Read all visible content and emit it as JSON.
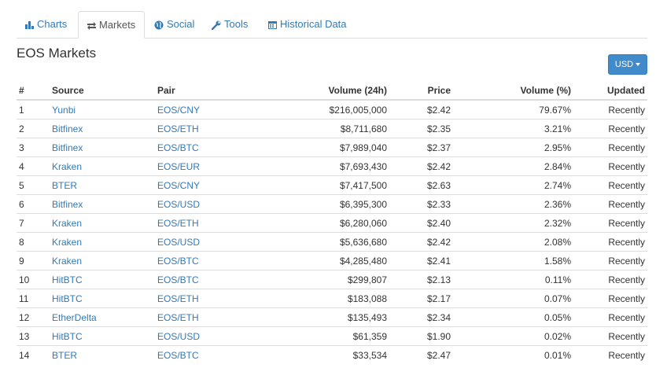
{
  "tabs": [
    {
      "label": "Charts",
      "icon": "bar-chart-icon"
    },
    {
      "label": "Markets",
      "icon": "exchange-icon"
    },
    {
      "label": "Social",
      "icon": "globe-icon"
    },
    {
      "label": "Tools",
      "icon": "wrench-icon"
    },
    {
      "label": "Historical Data",
      "icon": "calendar-icon"
    }
  ],
  "active_tab": "Markets",
  "page_title": "EOS Markets",
  "currency_button": "USD",
  "table": {
    "headers": [
      "#",
      "Source",
      "Pair",
      "Volume (24h)",
      "Price",
      "Volume (%)",
      "Updated"
    ],
    "rows": [
      [
        "1",
        "Yunbi",
        "EOS/CNY",
        "$216,005,000",
        "$2.42",
        "79.67%",
        "Recently"
      ],
      [
        "2",
        "Bitfinex",
        "EOS/ETH",
        "$8,711,680",
        "$2.35",
        "3.21%",
        "Recently"
      ],
      [
        "3",
        "Bitfinex",
        "EOS/BTC",
        "$7,989,040",
        "$2.37",
        "2.95%",
        "Recently"
      ],
      [
        "4",
        "Kraken",
        "EOS/EUR",
        "$7,693,430",
        "$2.42",
        "2.84%",
        "Recently"
      ],
      [
        "5",
        "BTER",
        "EOS/CNY",
        "$7,417,500",
        "$2.63",
        "2.74%",
        "Recently"
      ],
      [
        "6",
        "Bitfinex",
        "EOS/USD",
        "$6,395,300",
        "$2.33",
        "2.36%",
        "Recently"
      ],
      [
        "7",
        "Kraken",
        "EOS/ETH",
        "$6,280,060",
        "$2.40",
        "2.32%",
        "Recently"
      ],
      [
        "8",
        "Kraken",
        "EOS/USD",
        "$5,636,680",
        "$2.42",
        "2.08%",
        "Recently"
      ],
      [
        "9",
        "Kraken",
        "EOS/BTC",
        "$4,285,480",
        "$2.41",
        "1.58%",
        "Recently"
      ],
      [
        "10",
        "HitBTC",
        "EOS/BTC",
        "$299,807",
        "$2.13",
        "0.11%",
        "Recently"
      ],
      [
        "11",
        "HitBTC",
        "EOS/ETH",
        "$183,088",
        "$2.17",
        "0.07%",
        "Recently"
      ],
      [
        "12",
        "EtherDelta",
        "EOS/ETH",
        "$135,493",
        "$2.34",
        "0.05%",
        "Recently"
      ],
      [
        "13",
        "HitBTC",
        "EOS/USD",
        "$61,359",
        "$1.90",
        "0.02%",
        "Recently"
      ],
      [
        "14",
        "BTER",
        "EOS/BTC",
        "$33,534",
        "$2.47",
        "0.01%",
        "Recently"
      ]
    ]
  },
  "colors": {
    "link": "#337ab7",
    "button": "#428bca",
    "border": "#dddddd",
    "text": "#333333"
  }
}
